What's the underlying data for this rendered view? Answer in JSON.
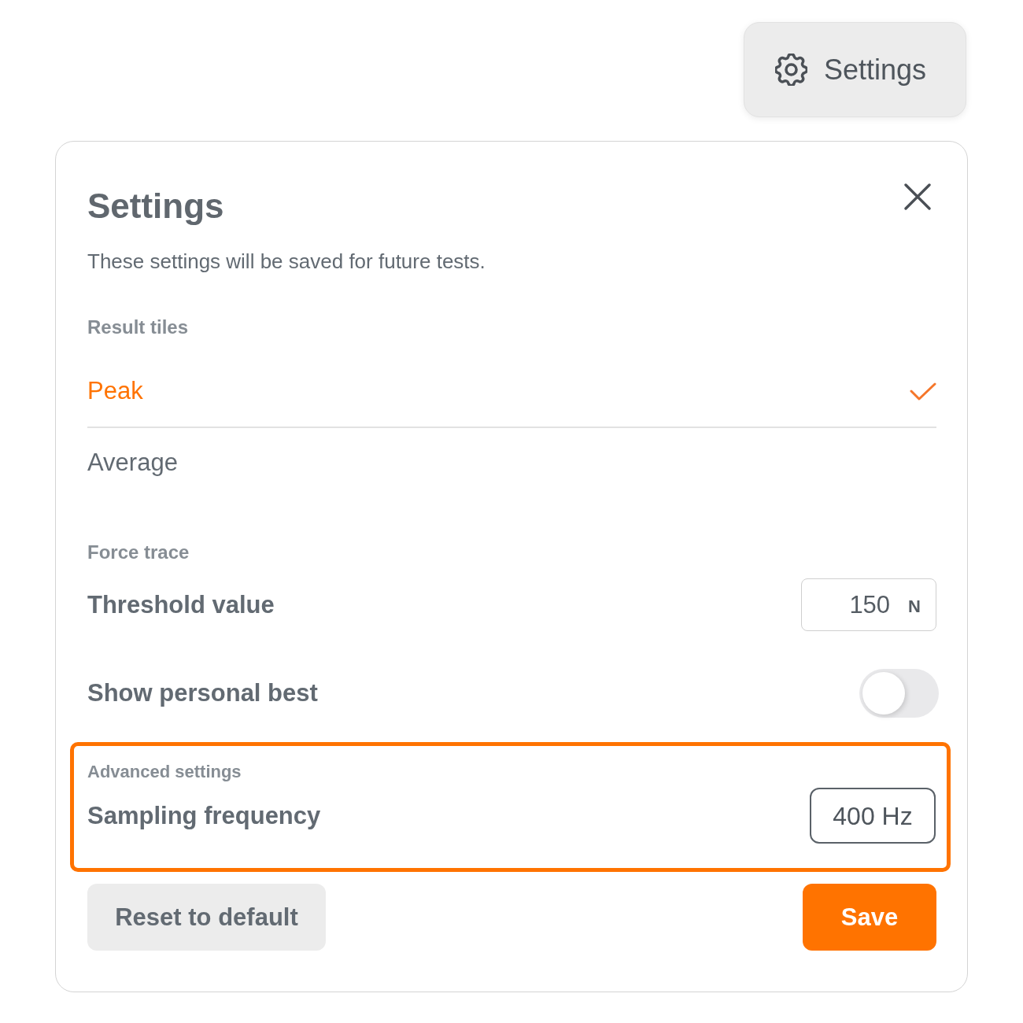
{
  "settings_button": {
    "label": "Settings"
  },
  "dialog": {
    "title": "Settings",
    "description": "These settings will be saved for future tests."
  },
  "result_tiles": {
    "heading": "Result tiles",
    "options": [
      {
        "label": "Peak",
        "selected": true
      },
      {
        "label": "Average",
        "selected": false
      }
    ]
  },
  "force_trace": {
    "heading": "Force trace",
    "threshold": {
      "label": "Threshold value",
      "value": "150",
      "unit": "N"
    },
    "personal_best": {
      "label": "Show personal best",
      "on": false
    }
  },
  "advanced": {
    "heading": "Advanced settings",
    "highlighted": true,
    "sampling": {
      "label": "Sampling frequency",
      "value": "400 Hz"
    }
  },
  "buttons": {
    "reset": "Reset to default",
    "save": "Save"
  }
}
